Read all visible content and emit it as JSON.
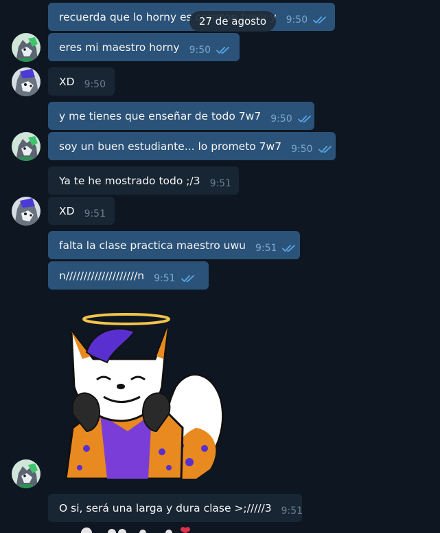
{
  "date_badge": "27 de agosto",
  "colors": {
    "background": "#0e1621",
    "outgoing_bubble": "#2b5278",
    "incoming_bubble": "#182533",
    "check_ticks": "#5aa7e6"
  },
  "messages": [
    {
      "text": "recuerda que lo horny es corazon fuwu y",
      "time": "9:50",
      "direction": "out",
      "status": "read"
    },
    {
      "text": "eres mi maestro horny",
      "time": "9:50",
      "direction": "out",
      "status": "read"
    },
    {
      "text": "XD",
      "time": "9:50",
      "direction": "in"
    },
    {
      "text": "y me tienes que enseñar de todo 7w7",
      "time": "9:50",
      "direction": "out",
      "status": "read"
    },
    {
      "text": "soy un buen estudiante... lo prometo 7w7",
      "time": "9:50",
      "direction": "out",
      "status": "read"
    },
    {
      "text": "Ya te he mostrado todo ;/3",
      "time": "9:51",
      "direction": "in"
    },
    {
      "text": "XD",
      "time": "9:51",
      "direction": "in"
    },
    {
      "text": "falta la clase practica maestro uwu",
      "time": "9:51",
      "direction": "out",
      "status": "read"
    },
    {
      "text": "n////////////////////n",
      "time": "9:51",
      "direction": "out",
      "status": "read"
    },
    {
      "text": "O si, será una larga y dura clase >;/////3",
      "time": "9:51",
      "direction": "out"
    }
  ],
  "sticker": {
    "icon": "angel-fox-sticker-icon"
  },
  "reactions": {
    "icons": [
      "heart-icon"
    ]
  }
}
